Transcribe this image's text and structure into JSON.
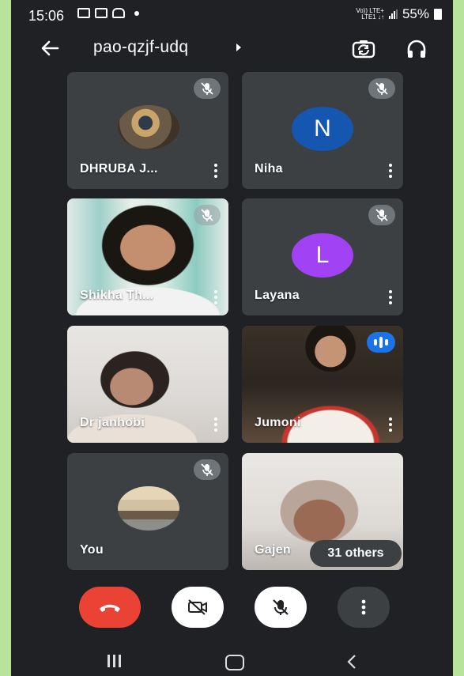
{
  "status_bar": {
    "time": "15:06",
    "lte_top": "Vo)) LTE+",
    "lte_bottom": "LTE1 ↓↑",
    "battery": "55%"
  },
  "header": {
    "meeting_code": "pao-qzjf-udq"
  },
  "participants": [
    {
      "name": "DHRUBA J...",
      "muted": true
    },
    {
      "name": "Niha",
      "muted": true,
      "initial": "N",
      "avatar_color": "#1557b0"
    },
    {
      "name": "Shikha Th...",
      "muted": true
    },
    {
      "name": "Layana",
      "muted": true,
      "initial": "L",
      "avatar_color": "#a142f4"
    },
    {
      "name": "Dr janhobi",
      "muted": false
    },
    {
      "name": "Jumoni",
      "muted": false,
      "speaking": true
    },
    {
      "name": "You",
      "muted": true
    },
    {
      "name": "Gajen"
    }
  ],
  "others_chip": "31 others",
  "colors": {
    "end_call": "#ea4335",
    "speaking": "#1a73e8",
    "background": "#202124",
    "tile": "#3c4043"
  }
}
